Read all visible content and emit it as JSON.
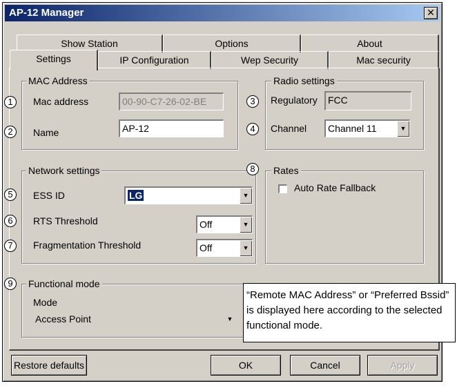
{
  "window": {
    "title": "AP-12 Manager",
    "close_glyph": "✕"
  },
  "tabs_row1": [
    "Show Station",
    "Options",
    "About"
  ],
  "tabs_row2": [
    "Settings",
    "IP Configuration",
    "Wep Security",
    "Mac security"
  ],
  "mac_group": {
    "label": "MAC Address",
    "mac_label": "Mac address",
    "mac_value": "00-90-C7-26-02-BE",
    "name_label": "Name",
    "name_value": "AP-12"
  },
  "radio_group": {
    "label": "Radio settings",
    "regulatory_label": "Regulatory",
    "regulatory_value": "FCC",
    "channel_label": "Channel",
    "channel_value": "Channel 11"
  },
  "network_group": {
    "label": "Network settings",
    "essid_label": "ESS ID",
    "essid_value": "LG",
    "rts_label": "RTS Threshold",
    "rts_value": "Off",
    "frag_label": "Fragmentation Threshold",
    "frag_value": "Off"
  },
  "rates_group": {
    "label": "Rates",
    "auto_rate_label": "Auto Rate Fallback"
  },
  "functional_group": {
    "label": "Functional mode",
    "mode_label": "Mode",
    "mode_value": "Access Point"
  },
  "callout_text": "“Remote MAC Address” or “Preferred Bssid” is displayed here according to the selected functional mode.",
  "markers": [
    "1",
    "2",
    "3",
    "4",
    "5",
    "6",
    "7",
    "8",
    "9"
  ],
  "buttons": {
    "restore": "Restore defaults",
    "ok": "OK",
    "cancel": "Cancel",
    "apply": "Apply"
  },
  "colors": {
    "face": "#d4d0c8",
    "title_start": "#0a246a",
    "title_end": "#a6caf0"
  }
}
